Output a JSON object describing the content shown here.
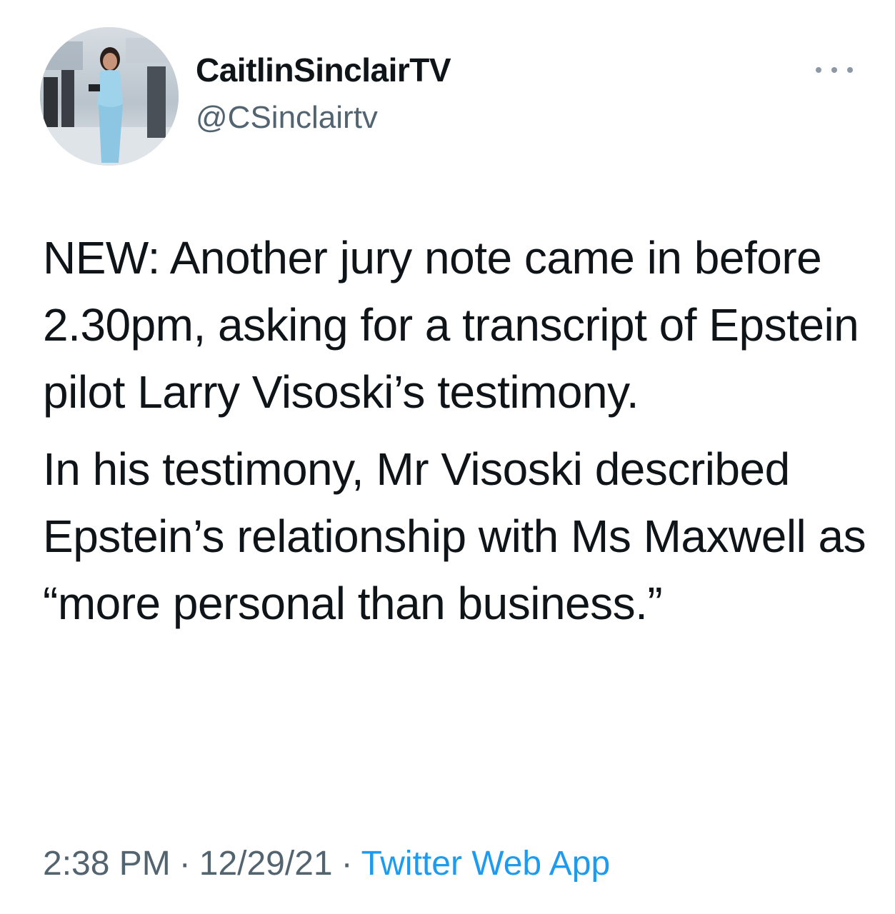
{
  "author": {
    "display_name": "CaitlinSinclairTV",
    "handle": "@CSinclairtv",
    "avatar_icon": "profile-photo"
  },
  "menu": {
    "icon": "more-horizontal-icon"
  },
  "tweet": {
    "paragraphs": [
      "NEW: Another jury note came in before 2.30pm, asking for a transcript of Epstein pilot Larry Visoski’s testimony.",
      "In his testimony, Mr Visoski described Epstein’s relationship with Ms Maxwell as “more personal than business.”"
    ],
    "time": "2:38 PM",
    "separator": "·",
    "date": "12/29/21",
    "source": "Twitter Web App"
  },
  "colors": {
    "text": "#0f1419",
    "secondary": "#536471",
    "link": "#1d9bf0"
  }
}
